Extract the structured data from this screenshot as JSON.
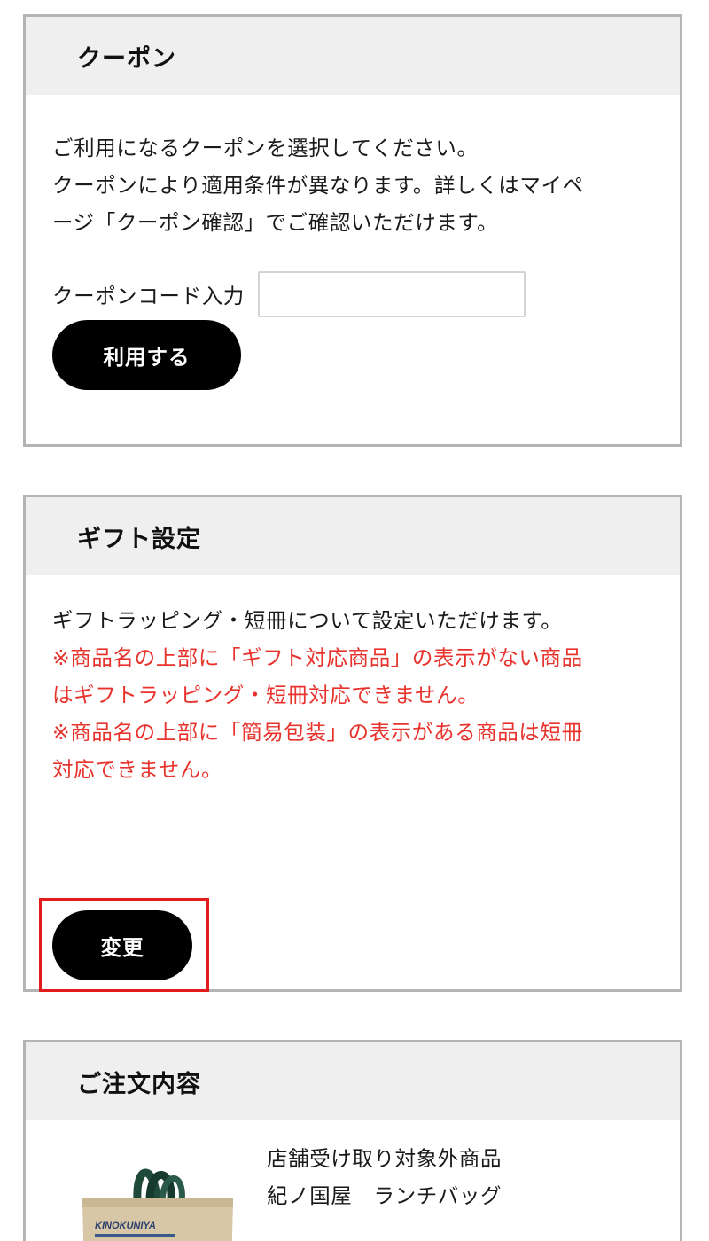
{
  "coupon": {
    "title": "クーポン",
    "description": [
      "ご利用になるクーポンを選択してください。",
      "クーポンにより適用条件が異なります。詳しくはマイペ",
      "ージ「クーポン確認」でご確認いただけます。"
    ],
    "code_label": "クーポンコード入力",
    "code_value": "",
    "apply_label": "利用する"
  },
  "gift": {
    "title": "ギフト設定",
    "description": "ギフトラッピング・短冊について設定いただけます。",
    "notes": [
      "※商品名の上部に「ギフト対応商品」の表示がない商品",
      "はギフトラッピング・短冊対応できません。",
      "※商品名の上部に「簡易包装」の表示がある商品は短冊",
      "対応できません。"
    ],
    "change_label": "変更"
  },
  "order": {
    "title": "ご注文内容",
    "item": {
      "pickup_note": "店舗受け取り対象外商品",
      "name": "紀ノ国屋　ランチバッグ",
      "image_brand_text": "KINOKUNIYA"
    }
  },
  "colors": {
    "accent_red": "#e8332d",
    "highlight_red": "#e31b1b",
    "button_bg": "#000000",
    "header_bg": "#efefef",
    "border": "#b4b4b4"
  },
  "icons": {
    "product_image": "tote-bag-image"
  }
}
